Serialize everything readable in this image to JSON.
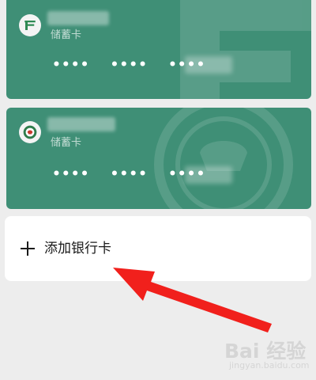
{
  "cards": [
    {
      "bank_logo_icon": "postal-bank-logo-icon",
      "type_label": "储蓄卡",
      "number_groups": [
        "••••",
        "••••",
        "••••"
      ],
      "accent": "#3f8f76"
    },
    {
      "bank_logo_icon": "rural-credit-logo-icon",
      "type_label": "储蓄卡",
      "number_groups": [
        "••••",
        "••••",
        "••••"
      ],
      "accent": "#3f8f76"
    }
  ],
  "add_card": {
    "label": "添加银行卡",
    "icon": "plus-icon"
  },
  "annotation": {
    "arrow_color": "#f1201c"
  },
  "watermark": {
    "brand_text": "Bai 经验",
    "url_text": "jingyan.baidu.com"
  },
  "colors": {
    "background": "#ededed",
    "card": "#3f8f76",
    "panel": "#ffffff"
  }
}
